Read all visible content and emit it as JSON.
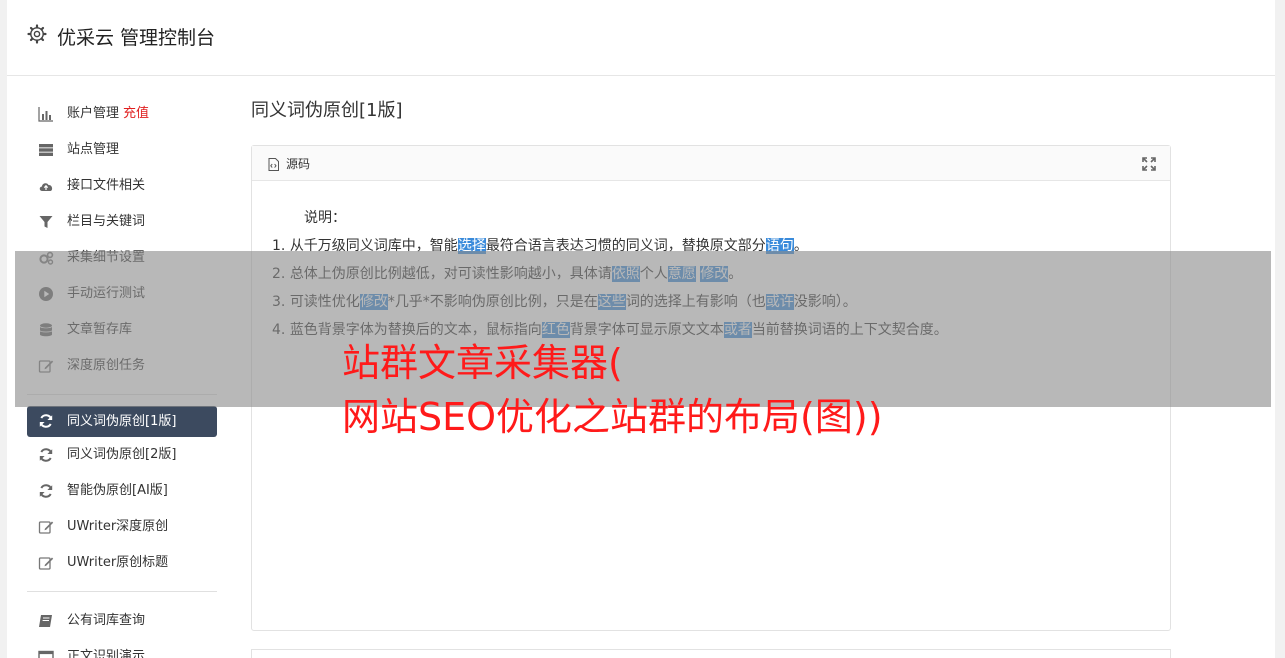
{
  "app": {
    "title": "优采云 管理控制台"
  },
  "sidebar": {
    "group1": [
      {
        "label": "账户管理",
        "badge": "充值",
        "icon": "bar-chart-icon"
      },
      {
        "label": "站点管理",
        "icon": "server-icon"
      },
      {
        "label": "接口文件相关",
        "icon": "cloud-upload-icon"
      },
      {
        "label": "栏目与关键词",
        "icon": "filter-icon"
      },
      {
        "label": "采集细节设置",
        "icon": "gears-icon"
      },
      {
        "label": "手动运行测试",
        "icon": "play-circle-icon"
      },
      {
        "label": "文章暂存库",
        "icon": "database-icon"
      },
      {
        "label": "深度原创任务",
        "icon": "edit-icon"
      }
    ],
    "group2": [
      {
        "label": "同义词伪原创[1版]",
        "icon": "refresh-icon",
        "active": true
      },
      {
        "label": "同义词伪原创[2版]",
        "icon": "refresh-icon"
      },
      {
        "label": "智能伪原创[AI版]",
        "icon": "refresh-icon"
      },
      {
        "label": "UWriter深度原创",
        "icon": "edit-icon"
      },
      {
        "label": "UWriter原创标题",
        "icon": "edit-icon"
      }
    ],
    "group3": [
      {
        "label": "公有词库查询",
        "icon": "book-icon"
      },
      {
        "label": "正文识别演示",
        "icon": "window-icon"
      }
    ]
  },
  "content": {
    "page_title": "同义词伪原创[1版]",
    "panel_label": "源码",
    "description_heading": "说明：",
    "lines": [
      {
        "prefix": "1. ",
        "segments": [
          {
            "t": "从千万级同义词库中，智能"
          },
          {
            "t": "选择",
            "hl": true
          },
          {
            "t": "最符合语言表达习惯的同义词，替换原文部分"
          },
          {
            "t": "语句",
            "hl": true
          },
          {
            "t": "。"
          }
        ]
      },
      {
        "prefix": "2. ",
        "segments": [
          {
            "t": "总体上伪原创比例越低，对可读性影响越小，具体请"
          },
          {
            "t": "依照",
            "hl": true
          },
          {
            "t": "个人"
          },
          {
            "t": "意愿",
            "hl": true
          },
          {
            "t": " "
          },
          {
            "t": "修改",
            "hl": true
          },
          {
            "t": "。"
          }
        ]
      },
      {
        "prefix": "3. ",
        "segments": [
          {
            "t": "可读性优化"
          },
          {
            "t": "修改",
            "hl": true
          },
          {
            "t": "*几乎*不影响伪原创比例，只是在"
          },
          {
            "t": "这些",
            "hl": true
          },
          {
            "t": "词的选择上有影响（也"
          },
          {
            "t": "或许",
            "hl": true
          },
          {
            "t": "没影响）。"
          }
        ]
      },
      {
        "prefix": "4. ",
        "segments": [
          {
            "t": "蓝色背景字体为替换后的文本，鼠标指向"
          },
          {
            "t": "红色",
            "hl": true
          },
          {
            "t": "背景字体可显示原文文本"
          },
          {
            "t": "或者",
            "hl": true
          },
          {
            "t": "当前替换词语的上下文契合度。"
          }
        ]
      }
    ]
  },
  "overlay": {
    "line1": "站群文章采集器(",
    "line2": "网站SEO优化之站群的布局(图))",
    "color": "#ff1a1a"
  },
  "colors": {
    "active_nav": "#3c4a5f",
    "highlight": "#3a8bdb",
    "recharge": "#e02020"
  }
}
